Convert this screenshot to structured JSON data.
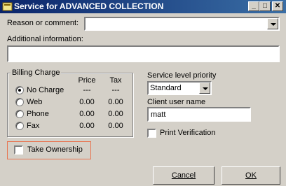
{
  "window": {
    "title": "Service for ADVANCED COLLECTION",
    "controls": {
      "minimize": "_",
      "maximize": "□",
      "close": "✕"
    }
  },
  "reason": {
    "label": "Reason or comment:",
    "value": ""
  },
  "additional": {
    "label": "Additional information:",
    "value": ""
  },
  "billing": {
    "title": "Billing Charge",
    "col_price": "Price",
    "col_tax": "Tax",
    "options": [
      {
        "label": "No Charge",
        "price": "---",
        "tax": "---",
        "selected": true
      },
      {
        "label": "Web",
        "price": "0.00",
        "tax": "0.00",
        "selected": false
      },
      {
        "label": "Phone",
        "price": "0.00",
        "tax": "0.00",
        "selected": false
      },
      {
        "label": "Fax",
        "price": "0.00",
        "tax": "0.00",
        "selected": false
      }
    ]
  },
  "service_level": {
    "label": "Service level priority",
    "value": "Standard"
  },
  "client_user": {
    "label": "Client user name",
    "value": "matt"
  },
  "print_verification": {
    "label": "Print Verification",
    "checked": false
  },
  "take_ownership": {
    "label": "Take Ownership",
    "checked": false,
    "highlight_color": "#e8734f"
  },
  "buttons": {
    "cancel": "Cancel",
    "ok": "OK"
  }
}
